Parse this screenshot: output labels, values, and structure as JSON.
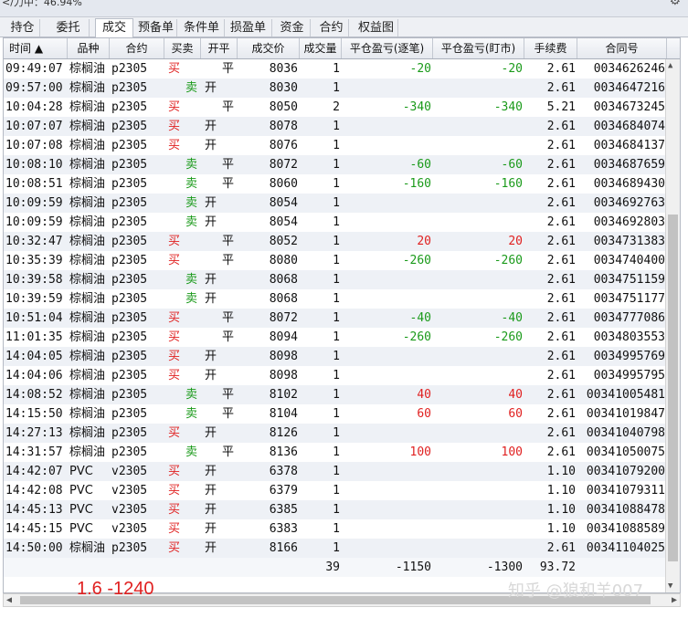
{
  "topbar": {
    "title": "</力中：46.94%"
  },
  "tabs": [
    {
      "label": "持仓"
    },
    {
      "label": "委托"
    },
    {
      "label": "成交"
    },
    {
      "label": "预备单"
    },
    {
      "label": "条件单"
    },
    {
      "label": "损盈单"
    },
    {
      "label": "资金"
    },
    {
      "label": "合约"
    },
    {
      "label": "权益图"
    }
  ],
  "active_tab": "成交",
  "columns": [
    "时间 ▲",
    "品种",
    "合约",
    "买卖",
    "开平",
    "成交价",
    "成交量",
    "平仓盈亏(逐笔)",
    "平仓盈亏(盯市)",
    "手续费",
    "合同号"
  ],
  "rows": [
    {
      "time": "09:49:07",
      "product": "棕榈油",
      "contract": "p2305",
      "side": "买",
      "oc": "平",
      "price": "8036",
      "qty": "1",
      "pnl_trade": "-20",
      "pnl_mtm": "-20",
      "fee": "2.61",
      "order_no": "0034626246"
    },
    {
      "time": "09:57:00",
      "product": "棕榈油",
      "contract": "p2305",
      "side": "卖",
      "oc": "开",
      "price": "8030",
      "qty": "1",
      "pnl_trade": "",
      "pnl_mtm": "",
      "fee": "2.61",
      "order_no": "0034647216"
    },
    {
      "time": "10:04:28",
      "product": "棕榈油",
      "contract": "p2305",
      "side": "买",
      "oc": "平",
      "price": "8050",
      "qty": "2",
      "pnl_trade": "-340",
      "pnl_mtm": "-340",
      "fee": "5.21",
      "order_no": "0034673245"
    },
    {
      "time": "10:07:07",
      "product": "棕榈油",
      "contract": "p2305",
      "side": "买",
      "oc": "开",
      "price": "8078",
      "qty": "1",
      "pnl_trade": "",
      "pnl_mtm": "",
      "fee": "2.61",
      "order_no": "0034684074"
    },
    {
      "time": "10:07:08",
      "product": "棕榈油",
      "contract": "p2305",
      "side": "买",
      "oc": "开",
      "price": "8076",
      "qty": "1",
      "pnl_trade": "",
      "pnl_mtm": "",
      "fee": "2.61",
      "order_no": "0034684137"
    },
    {
      "time": "10:08:10",
      "product": "棕榈油",
      "contract": "p2305",
      "side": "卖",
      "oc": "平",
      "price": "8072",
      "qty": "1",
      "pnl_trade": "-60",
      "pnl_mtm": "-60",
      "fee": "2.61",
      "order_no": "0034687659"
    },
    {
      "time": "10:08:51",
      "product": "棕榈油",
      "contract": "p2305",
      "side": "卖",
      "oc": "平",
      "price": "8060",
      "qty": "1",
      "pnl_trade": "-160",
      "pnl_mtm": "-160",
      "fee": "2.61",
      "order_no": "0034689430"
    },
    {
      "time": "10:09:59",
      "product": "棕榈油",
      "contract": "p2305",
      "side": "卖",
      "oc": "开",
      "price": "8054",
      "qty": "1",
      "pnl_trade": "",
      "pnl_mtm": "",
      "fee": "2.61",
      "order_no": "0034692763"
    },
    {
      "time": "10:09:59",
      "product": "棕榈油",
      "contract": "p2305",
      "side": "卖",
      "oc": "开",
      "price": "8054",
      "qty": "1",
      "pnl_trade": "",
      "pnl_mtm": "",
      "fee": "2.61",
      "order_no": "0034692803"
    },
    {
      "time": "10:32:47",
      "product": "棕榈油",
      "contract": "p2305",
      "side": "买",
      "oc": "平",
      "price": "8052",
      "qty": "1",
      "pnl_trade": "20",
      "pnl_mtm": "20",
      "fee": "2.61",
      "order_no": "0034731383"
    },
    {
      "time": "10:35:39",
      "product": "棕榈油",
      "contract": "p2305",
      "side": "买",
      "oc": "平",
      "price": "8080",
      "qty": "1",
      "pnl_trade": "-260",
      "pnl_mtm": "-260",
      "fee": "2.61",
      "order_no": "0034740400"
    },
    {
      "time": "10:39:58",
      "product": "棕榈油",
      "contract": "p2305",
      "side": "卖",
      "oc": "开",
      "price": "8068",
      "qty": "1",
      "pnl_trade": "",
      "pnl_mtm": "",
      "fee": "2.61",
      "order_no": "0034751159"
    },
    {
      "time": "10:39:59",
      "product": "棕榈油",
      "contract": "p2305",
      "side": "卖",
      "oc": "开",
      "price": "8068",
      "qty": "1",
      "pnl_trade": "",
      "pnl_mtm": "",
      "fee": "2.61",
      "order_no": "0034751177"
    },
    {
      "time": "10:51:04",
      "product": "棕榈油",
      "contract": "p2305",
      "side": "买",
      "oc": "平",
      "price": "8072",
      "qty": "1",
      "pnl_trade": "-40",
      "pnl_mtm": "-40",
      "fee": "2.61",
      "order_no": "0034777086"
    },
    {
      "time": "11:01:35",
      "product": "棕榈油",
      "contract": "p2305",
      "side": "买",
      "oc": "平",
      "price": "8094",
      "qty": "1",
      "pnl_trade": "-260",
      "pnl_mtm": "-260",
      "fee": "2.61",
      "order_no": "0034803553"
    },
    {
      "time": "14:04:05",
      "product": "棕榈油",
      "contract": "p2305",
      "side": "买",
      "oc": "开",
      "price": "8098",
      "qty": "1",
      "pnl_trade": "",
      "pnl_mtm": "",
      "fee": "2.61",
      "order_no": "0034995769"
    },
    {
      "time": "14:04:06",
      "product": "棕榈油",
      "contract": "p2305",
      "side": "买",
      "oc": "开",
      "price": "8098",
      "qty": "1",
      "pnl_trade": "",
      "pnl_mtm": "",
      "fee": "2.61",
      "order_no": "0034995795"
    },
    {
      "time": "14:08:52",
      "product": "棕榈油",
      "contract": "p2305",
      "side": "卖",
      "oc": "平",
      "price": "8102",
      "qty": "1",
      "pnl_trade": "40",
      "pnl_mtm": "40",
      "fee": "2.61",
      "order_no": "00341005481"
    },
    {
      "time": "14:15:50",
      "product": "棕榈油",
      "contract": "p2305",
      "side": "卖",
      "oc": "平",
      "price": "8104",
      "qty": "1",
      "pnl_trade": "60",
      "pnl_mtm": "60",
      "fee": "2.61",
      "order_no": "00341019847"
    },
    {
      "time": "14:27:13",
      "product": "棕榈油",
      "contract": "p2305",
      "side": "买",
      "oc": "开",
      "price": "8126",
      "qty": "1",
      "pnl_trade": "",
      "pnl_mtm": "",
      "fee": "2.61",
      "order_no": "00341040798"
    },
    {
      "time": "14:31:57",
      "product": "棕榈油",
      "contract": "p2305",
      "side": "卖",
      "oc": "平",
      "price": "8136",
      "qty": "1",
      "pnl_trade": "100",
      "pnl_mtm": "100",
      "fee": "2.61",
      "order_no": "00341050075"
    },
    {
      "time": "14:42:07",
      "product": "PVC",
      "contract": "v2305",
      "side": "买",
      "oc": "开",
      "price": "6378",
      "qty": "1",
      "pnl_trade": "",
      "pnl_mtm": "",
      "fee": "1.10",
      "order_no": "00341079200"
    },
    {
      "time": "14:42:08",
      "product": "PVC",
      "contract": "v2305",
      "side": "买",
      "oc": "开",
      "price": "6379",
      "qty": "1",
      "pnl_trade": "",
      "pnl_mtm": "",
      "fee": "1.10",
      "order_no": "00341079311"
    },
    {
      "time": "14:45:13",
      "product": "PVC",
      "contract": "v2305",
      "side": "买",
      "oc": "开",
      "price": "6385",
      "qty": "1",
      "pnl_trade": "",
      "pnl_mtm": "",
      "fee": "1.10",
      "order_no": "00341088478"
    },
    {
      "time": "14:45:15",
      "product": "PVC",
      "contract": "v2305",
      "side": "买",
      "oc": "开",
      "price": "6383",
      "qty": "1",
      "pnl_trade": "",
      "pnl_mtm": "",
      "fee": "1.10",
      "order_no": "00341088589"
    },
    {
      "time": "14:50:00",
      "product": "棕榈油",
      "contract": "p2305",
      "side": "买",
      "oc": "开",
      "price": "8166",
      "qty": "1",
      "pnl_trade": "",
      "pnl_mtm": "",
      "fee": "2.61",
      "order_no": "00341104025"
    }
  ],
  "totals": {
    "qty": "39",
    "pnl_trade": "-1150",
    "pnl_mtm": "-1300",
    "fee": "93.72"
  },
  "annotation": "1.6  -1240",
  "watermark": "知乎 @狼和羊007",
  "colors": {
    "buy": "#e02020",
    "sell": "#1a9a1a",
    "alt_row": "#eef1f6"
  },
  "icons": {
    "settings": "gear-icon"
  }
}
